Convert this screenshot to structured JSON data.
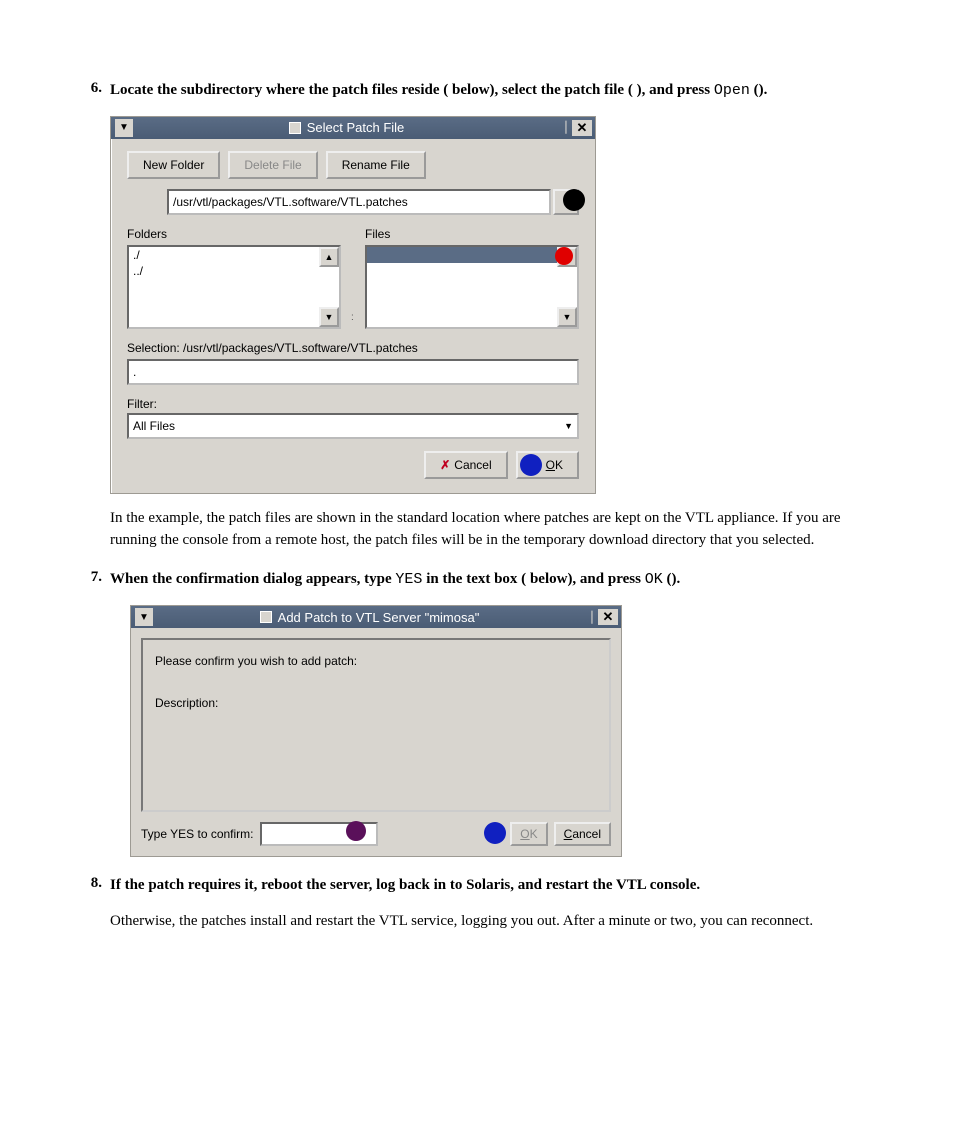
{
  "steps": {
    "s6": {
      "num": "6.",
      "text_a": "Locate the subdirectory where the patch files reside (",
      "text_b": " below), select the patch file (",
      "text_c": "), and press ",
      "open_word": "Open",
      "text_d": " (",
      "text_e": ")."
    },
    "para1": "In the example, the patch files are shown in the standard location where patches are kept on the VTL appliance. If you are running the console from a remote host, the patch files will be in the temporary download directory that you selected.",
    "s7": {
      "num": "7.",
      "text_a": "When the confirmation dialog appears, type ",
      "yes_word": "YES",
      "text_b": " in the text box (",
      "text_c": " below), and press ",
      "ok_word": "OK",
      "text_d": " (",
      "text_e": ")."
    },
    "s8": {
      "num": "8.",
      "text": "If the patch requires it, reboot the server, log back in to Solaris, and restart the VTL console."
    },
    "para2": "Otherwise, the patches install and restart the VTL service, logging you out. After a minute or two, you can reconnect."
  },
  "dialog1": {
    "title": "Select Patch File",
    "new_folder": "New Folder",
    "delete_file": "Delete File",
    "rename_file": "Rename File",
    "path_value": "/usr/vtl/packages/VTL.software/VTL.patches",
    "folders_label": "Folders",
    "files_label": "Files",
    "folder_items": [
      "./",
      "../"
    ],
    "selection_label": "Selection: /usr/vtl/packages/VTL.software/VTL.patches",
    "selection_value": ".",
    "filter_label": "Filter:",
    "filter_value": "All Files",
    "cancel": "Cancel",
    "ok": "OK"
  },
  "dialog2": {
    "title": "Add Patch to VTL Server \"mimosa\"",
    "confirm_line": "Please confirm you wish to add patch:",
    "desc_label": "Description:",
    "type_label": "Type YES to confirm:",
    "ok": "OK",
    "cancel": "Cancel"
  },
  "markers": {
    "black": "#000000",
    "red": "#e00000",
    "blue": "#1020c0",
    "purple": "#5a105a"
  }
}
